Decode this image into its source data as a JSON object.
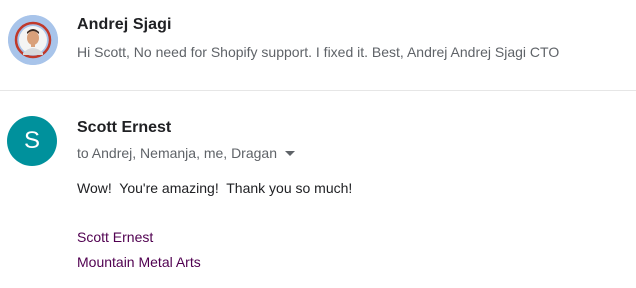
{
  "messages": [
    {
      "sender": "Andrej Sjagi",
      "snippet": "Hi Scott, No need for Shopify support. I fixed it. Best, Andrej Andrej Sjagi CTO",
      "avatar": {
        "type": "photo",
        "background": "#a8c4ea"
      }
    },
    {
      "sender": "Scott Ernest",
      "avatar": {
        "type": "letter",
        "letter": "S",
        "background": "#00919c"
      },
      "recipients": "to Andrej, Nemanja, me, Dragan",
      "body": "Wow!  You're amazing!  Thank you so much!",
      "signature": {
        "name": "Scott Ernest",
        "company": "Mountain Metal Arts",
        "color": "#500050"
      }
    }
  ]
}
